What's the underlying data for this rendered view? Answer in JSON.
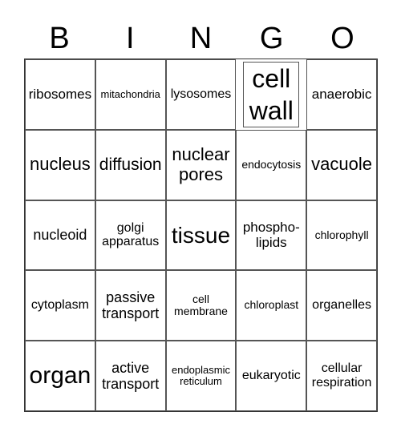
{
  "header": {
    "letters": [
      "B",
      "I",
      "N",
      "G",
      "O"
    ]
  },
  "grid": {
    "cells": [
      [
        "ribosomes",
        "mitachondria",
        "lysosomes",
        "cell wall",
        "anaerobic"
      ],
      [
        "nucleus",
        "diffusion",
        "nuclear pores",
        "endocytosis",
        "vacuole"
      ],
      [
        "nucleoid",
        "golgi apparatus",
        "tissue",
        "phospho- lipids",
        "chlorophyll"
      ],
      [
        "cytoplasm",
        "passive transport",
        "cell membrane",
        "chloroplast",
        "organelles"
      ],
      [
        "organ",
        "active transport",
        "endoplasmic reticulum",
        "eukaryotic",
        "cellular respiration"
      ]
    ]
  }
}
